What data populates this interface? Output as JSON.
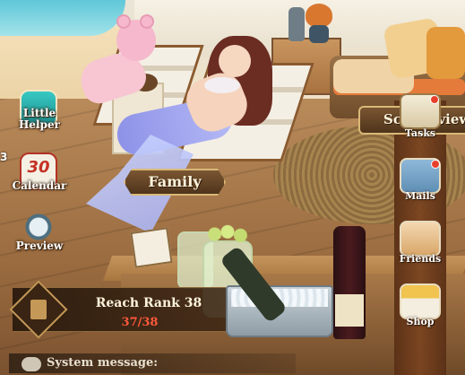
{
  "left_menu": {
    "little_helper": {
      "label": "Little Helper",
      "icon": "little-helper-icon"
    },
    "calendar": {
      "label": "Calendar",
      "day": "30",
      "icon": "calendar-icon"
    },
    "preview": {
      "label": "Preview",
      "icon": "magnifier-icon"
    },
    "edge_number": "3"
  },
  "family": {
    "label": "Family"
  },
  "right_menu": {
    "scenic_view": {
      "label": "Scenic view"
    },
    "tasks": {
      "label": "Tasks",
      "icon": "quill-scroll-icon",
      "has_alert": true
    },
    "mails": {
      "label": "Mails",
      "icon": "mailbox-icon",
      "has_alert": true
    },
    "friends": {
      "label": "Friends",
      "icon": "friends-icon"
    },
    "shop": {
      "label": "Shop",
      "icon": "shop-stall-icon"
    }
  },
  "quest": {
    "title": "Reach Rank 38",
    "progress": "37/38",
    "progress_value": 0.974
  },
  "system": {
    "label": "System message:"
  },
  "colors": {
    "banner": "#4f341b",
    "banner_border": "#d9b977",
    "progress_text": "#ff5a3c",
    "alert": "#e8402c"
  }
}
